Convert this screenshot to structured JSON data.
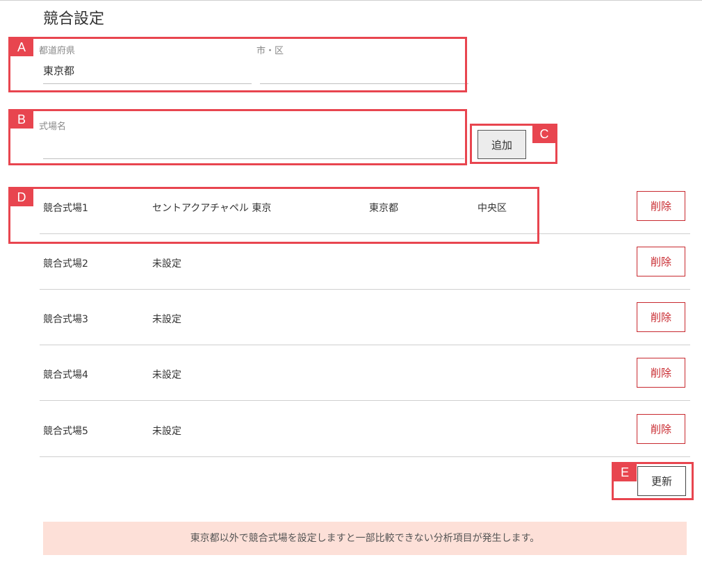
{
  "page": {
    "title": "競合設定"
  },
  "location": {
    "prefecture_label": "都道府県",
    "prefecture_value": "東京都",
    "city_label": "市・区",
    "city_value": ""
  },
  "venue_name": {
    "label": "式場名",
    "value": ""
  },
  "add_button": {
    "label": "追加"
  },
  "annotations": {
    "a": "A",
    "b": "B",
    "c": "C",
    "d": "D",
    "e": "E"
  },
  "competitors": [
    {
      "label": "競合式場1",
      "name": "セントアクアチャペル 東京",
      "prefecture": "東京都",
      "city": "中央区",
      "delete_label": "削除"
    },
    {
      "label": "競合式場2",
      "name": "未設定",
      "prefecture": "",
      "city": "",
      "delete_label": "削除"
    },
    {
      "label": "競合式場3",
      "name": "未設定",
      "prefecture": "",
      "city": "",
      "delete_label": "削除"
    },
    {
      "label": "競合式場4",
      "name": "未設定",
      "prefecture": "",
      "city": "",
      "delete_label": "削除"
    },
    {
      "label": "競合式場5",
      "name": "未設定",
      "prefecture": "",
      "city": "",
      "delete_label": "削除"
    }
  ],
  "update_button": {
    "label": "更新"
  },
  "notice": {
    "text": "東京都以外で競合式場を設定しますと一部比較できない分析項目が発生します。"
  },
  "colors": {
    "annotation": "#e8454f",
    "danger": "#c8282e",
    "notice_bg": "#fde0d8"
  }
}
